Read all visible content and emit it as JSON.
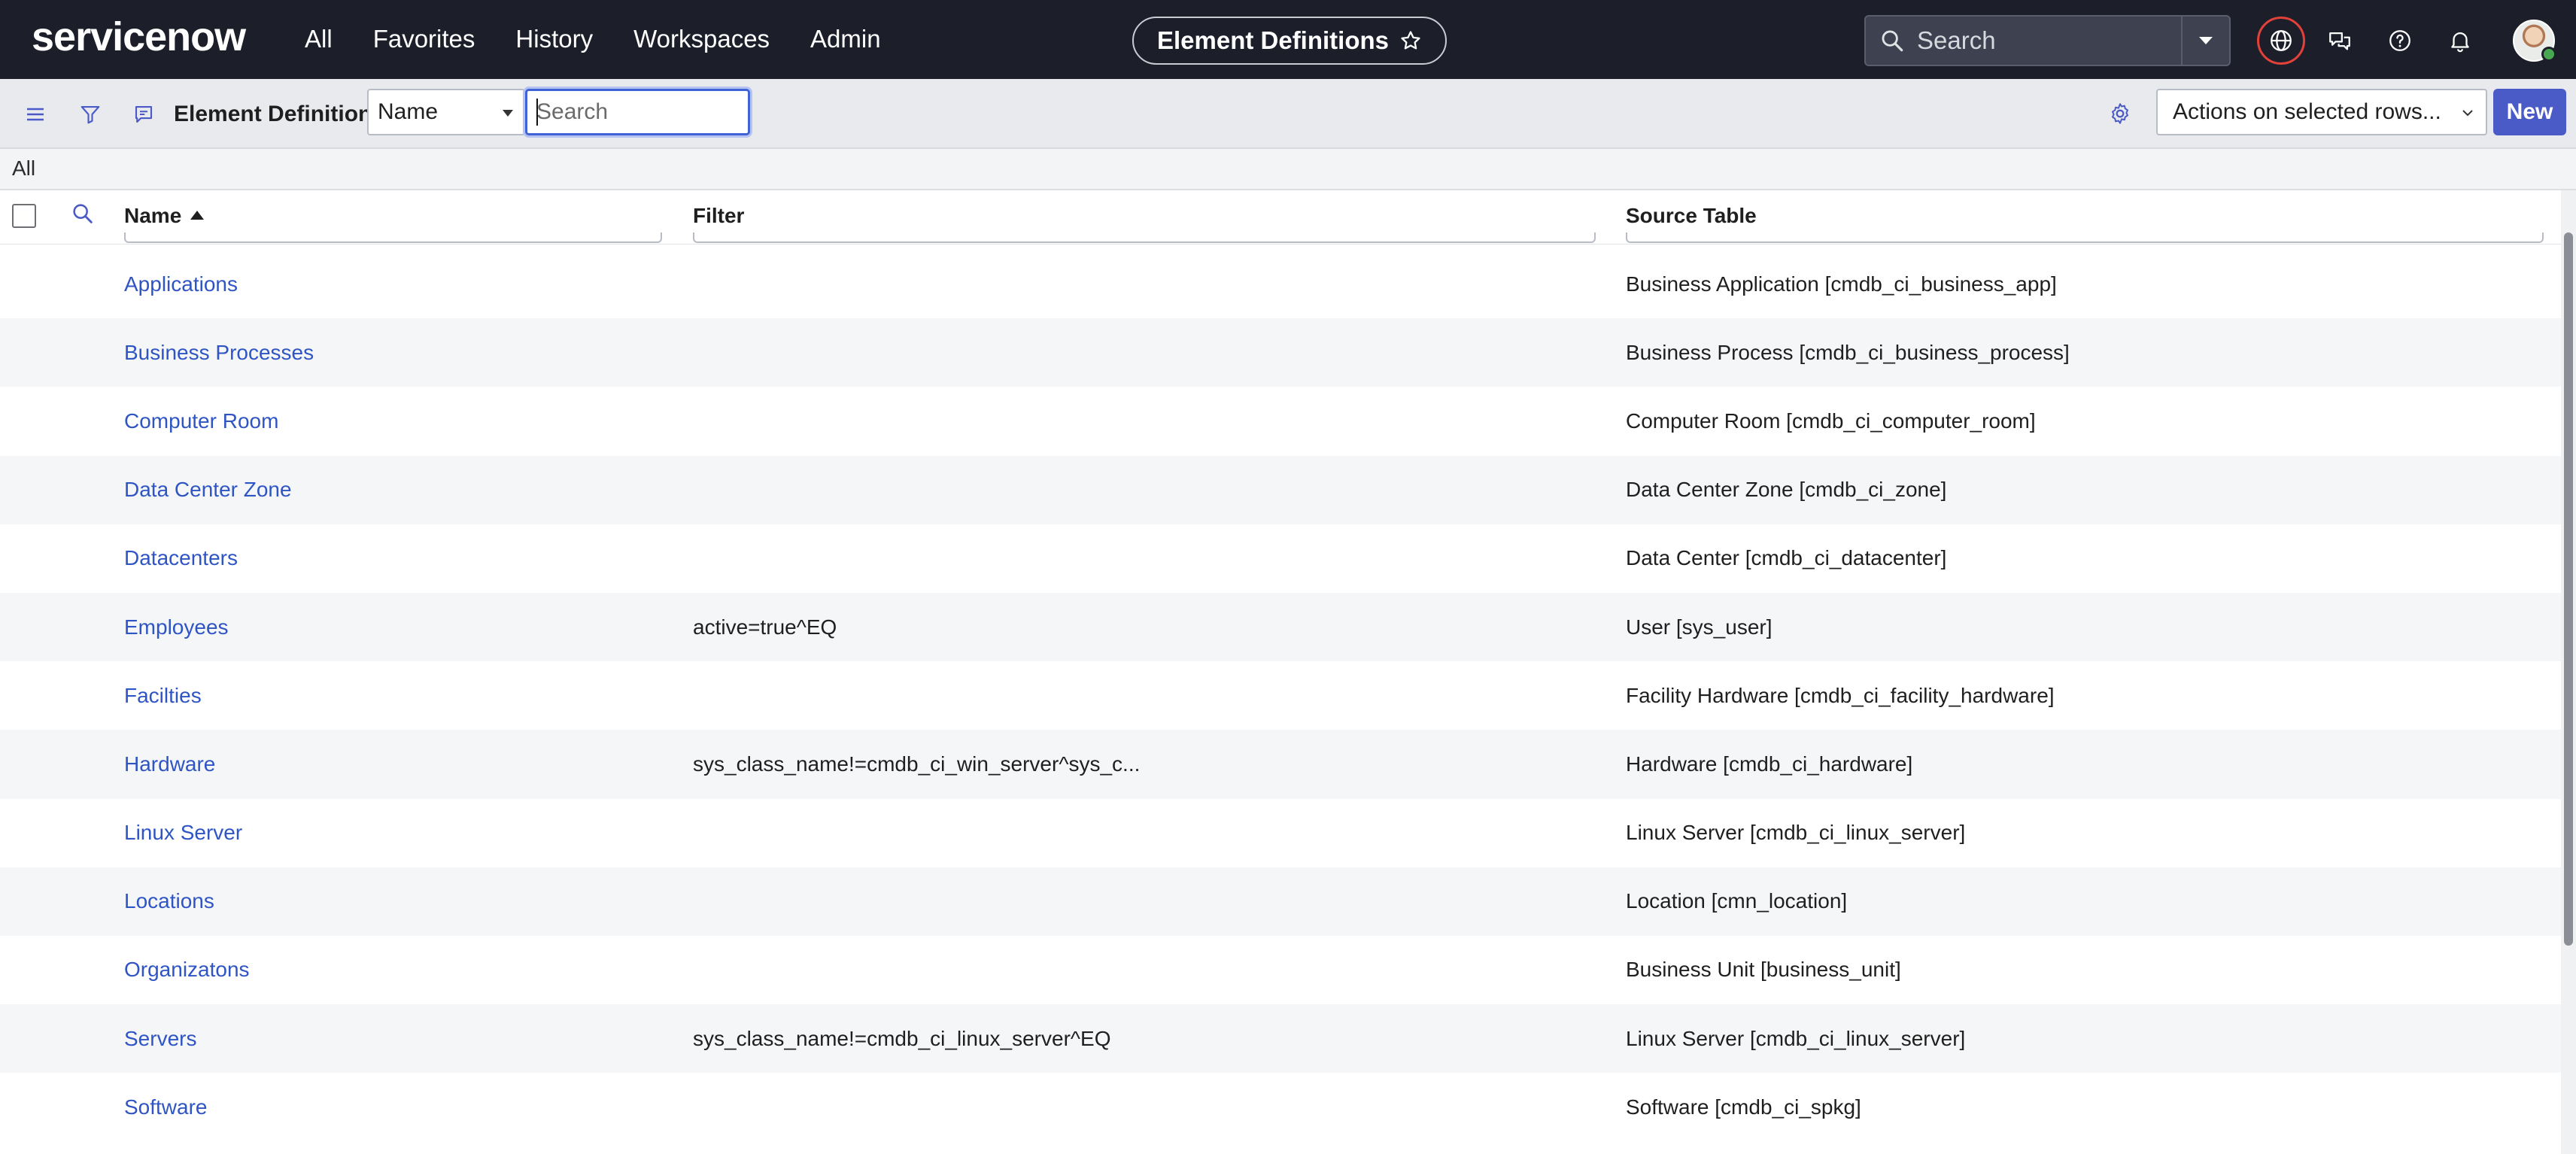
{
  "header": {
    "logo_text": "servicenow",
    "nav": [
      "All",
      "Favorites",
      "History",
      "Workspaces",
      "Admin"
    ],
    "page_title": "Element Definitions",
    "search_placeholder": "Search",
    "icons": [
      "globe-icon",
      "chat-icon",
      "help-icon",
      "bell-icon"
    ],
    "colors": {
      "nav_bg": "#1c1f2a",
      "globe_ring": "#e2413a",
      "logo_dot": "#62d84e"
    }
  },
  "toolbar": {
    "title": "Element Definitions",
    "field_select": "Name",
    "search_placeholder": "Search",
    "actions_select": "Actions on selected rows...",
    "new_label": "New",
    "accent": "#4a5bc7"
  },
  "breadcrumb": {
    "label": "All"
  },
  "table": {
    "columns": {
      "name": "Name",
      "filter": "Filter",
      "source": "Source Table"
    },
    "sort": {
      "column": "Name",
      "direction": "ascending"
    },
    "rows": [
      {
        "name": "Applications",
        "filter": "",
        "source": "Business Application [cmdb_ci_business_app]"
      },
      {
        "name": "Business Processes",
        "filter": "",
        "source": "Business Process [cmdb_ci_business_process]"
      },
      {
        "name": "Computer Room",
        "filter": "",
        "source": "Computer Room [cmdb_ci_computer_room]"
      },
      {
        "name": "Data Center Zone",
        "filter": "",
        "source": "Data Center Zone [cmdb_ci_zone]"
      },
      {
        "name": "Datacenters",
        "filter": "",
        "source": "Data Center [cmdb_ci_datacenter]"
      },
      {
        "name": "Employees",
        "filter": "active=true^EQ",
        "source": "User [sys_user]"
      },
      {
        "name": "Facilties",
        "filter": "",
        "source": "Facility Hardware [cmdb_ci_facility_hardware]"
      },
      {
        "name": "Hardware",
        "filter": "sys_class_name!=cmdb_ci_win_server^sys_c...",
        "source": "Hardware [cmdb_ci_hardware]"
      },
      {
        "name": "Linux Server",
        "filter": "",
        "source": "Linux Server [cmdb_ci_linux_server]"
      },
      {
        "name": "Locations",
        "filter": "",
        "source": "Location [cmn_location]"
      },
      {
        "name": "Organizatons",
        "filter": "",
        "source": "Business Unit [business_unit]"
      },
      {
        "name": "Servers",
        "filter": "sys_class_name!=cmdb_ci_linux_server^EQ",
        "source": "Linux Server [cmdb_ci_linux_server]"
      },
      {
        "name": "Software",
        "filter": "",
        "source": "Software [cmdb_ci_spkg]"
      }
    ]
  }
}
